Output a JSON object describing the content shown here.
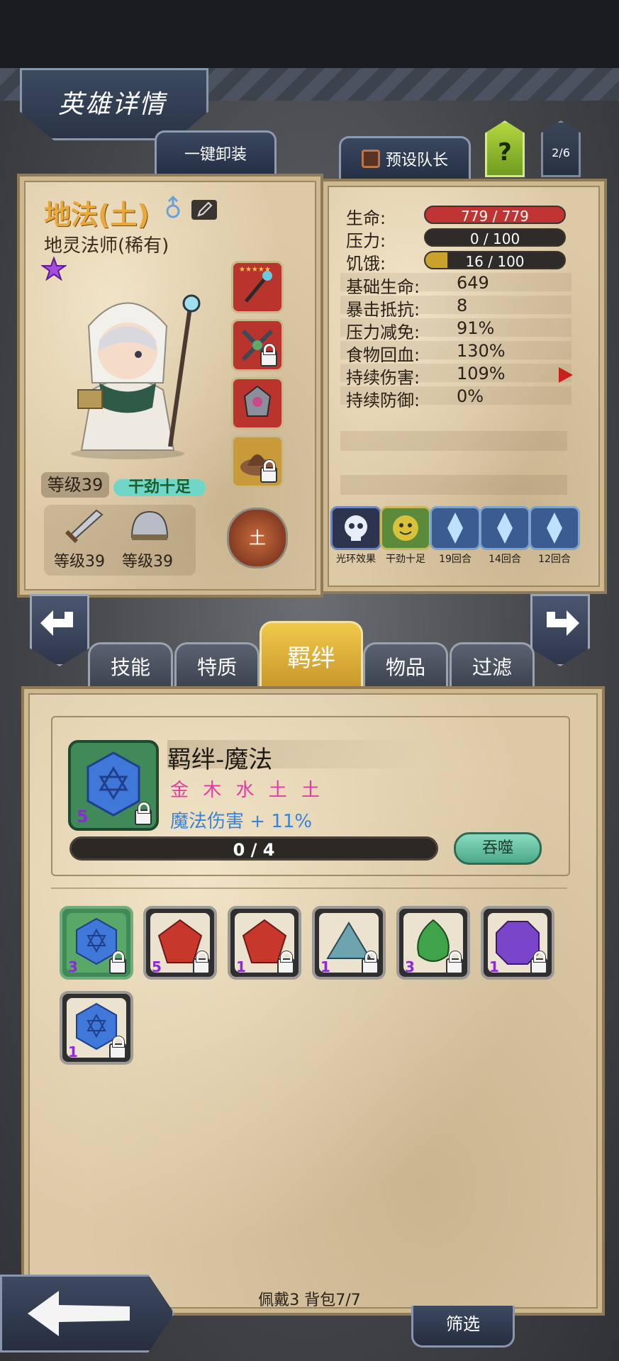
{
  "header": {
    "title": "英雄详情"
  },
  "top_tabs": {
    "unequip_all": "一键卸装",
    "preset_leader": "预设队长",
    "help": "?",
    "page": "2/6"
  },
  "hero": {
    "name": "地法(土)",
    "subtitle": "地灵法师(稀有)",
    "level": "等级39",
    "mood": "干劲十足",
    "weapon_level": "等级39",
    "armor_level": "等级39",
    "element": "土"
  },
  "stats": {
    "hp_label": "生命:",
    "hp_value": "779 / 779",
    "hp_fraction": 1.0,
    "stress_label": "压力:",
    "stress_value": "0 / 100",
    "stress_fraction": 0.0,
    "hunger_label": "饥饿:",
    "hunger_value": "16 / 100",
    "hunger_fraction": 0.16,
    "rows": [
      {
        "label": "基础生命:",
        "value": "649"
      },
      {
        "label": "暴击抵抗:",
        "value": "8"
      },
      {
        "label": "压力减免:",
        "value": "91%"
      },
      {
        "label": "食物回血:",
        "value": "130%"
      },
      {
        "label": "持续伤害:",
        "value": "109%"
      },
      {
        "label": "持续防御:",
        "value": "0%"
      }
    ],
    "effects": [
      "光环效果",
      "干劲十足",
      "19回合",
      "14回合",
      "12回合"
    ]
  },
  "tabs": [
    "技能",
    "特质",
    "羁绊",
    "物品",
    "过滤"
  ],
  "bond": {
    "title": "羁绊-魔法",
    "elements": "金 木 水 土 土",
    "bonus": "魔法伤害 + 11%",
    "count": "5",
    "progress": "0 / 4",
    "progress_fraction": 0.0,
    "devour": "吞噬"
  },
  "gems": [
    {
      "count": "3",
      "color": "#3f78d8"
    },
    {
      "count": "5",
      "color": "#c8372b"
    },
    {
      "count": "1",
      "color": "#c8372b"
    },
    {
      "count": "1",
      "color": "#6ea3b0"
    },
    {
      "count": "3",
      "color": "#3fa34a"
    },
    {
      "count": "1",
      "color": "#7a45c8"
    },
    {
      "count": "1",
      "color": "#3f78d8"
    }
  ],
  "footer": {
    "inventory": "佩戴3 背包7/7",
    "filter": "筛选"
  },
  "colors": {
    "accent_gold": "#e2b93a",
    "hp_red": "#c03434"
  }
}
